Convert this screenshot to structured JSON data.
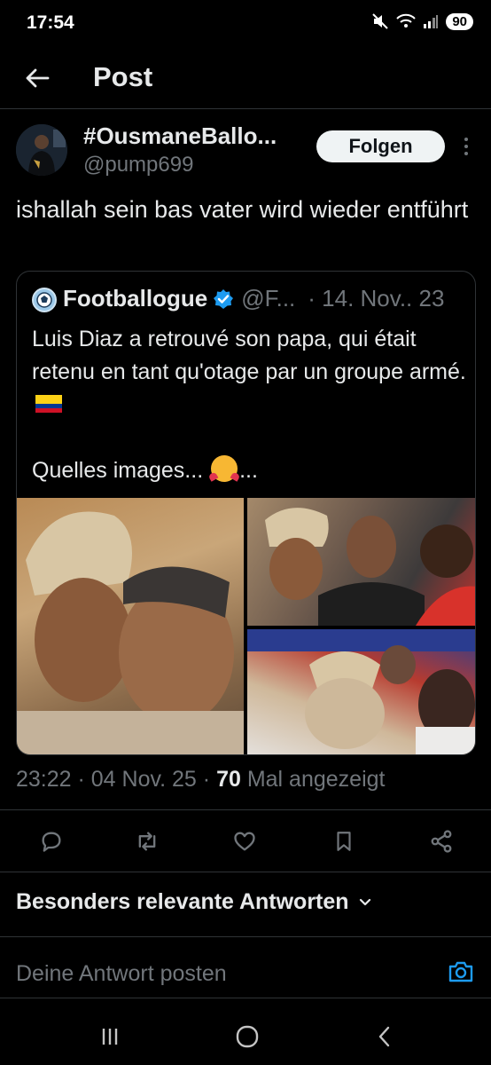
{
  "status_bar": {
    "time": "17:54",
    "battery": "90"
  },
  "header": {
    "title": "Post"
  },
  "tweet": {
    "author_name": "#OusmaneBallo...",
    "author_handle": "@pump699",
    "follow_label": "Folgen",
    "text": "ishallah sein bas vater wird wieder entführt"
  },
  "quote": {
    "name": "Footballogue",
    "handle": "@F...",
    "date": "· 14. Nov.. 23",
    "text_line1": "Luis Diaz a retrouvé son papa, qui était retenu en tant qu'otage par un groupe armé.",
    "text_line2": "Quelles images...",
    "text_line2_end": "..."
  },
  "meta": {
    "time_date": "23:22 · 04 Nov. 25 ·",
    "views_count": "70",
    "views_label": "Mal angezeigt"
  },
  "replies": {
    "filter_label": "Besonders relevante Antworten",
    "reply_placeholder": "Deine Antwort posten"
  },
  "colors": {
    "background": "#000000",
    "text": "#e7e9ea",
    "secondary_text": "#71767b",
    "accent": "#1d9bf0",
    "divider": "#2f3336"
  }
}
